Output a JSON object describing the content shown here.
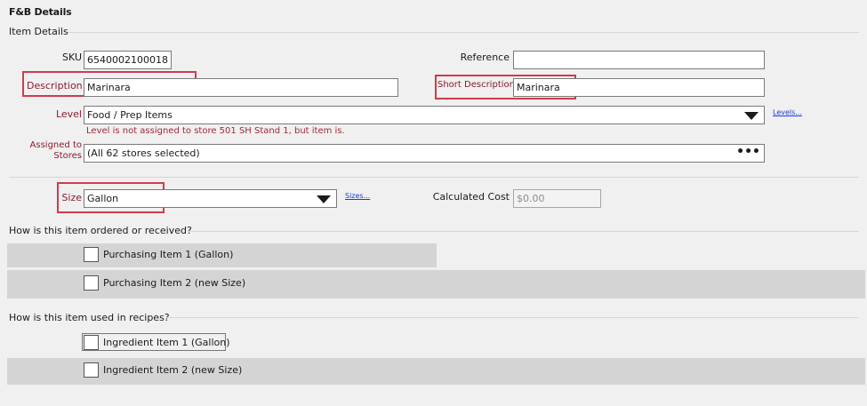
{
  "header": {
    "title": "F&B Details"
  },
  "item_details": {
    "section_label": "Item Details",
    "sku": {
      "label": "SKU",
      "value": "6540002100018"
    },
    "reference": {
      "label": "Reference",
      "value": ""
    },
    "description": {
      "label": "Description",
      "value": "Marinara"
    },
    "short_description": {
      "label": "Short Description",
      "value": "Marinara"
    },
    "level": {
      "label": "Level",
      "value": "Food / Prep Items",
      "link": "Levels...",
      "warning": "Level is not assigned to store 501 SH Stand 1, but item is."
    },
    "assigned_stores": {
      "label_line1": "Assigned to",
      "label_line2": "Stores",
      "value": "(All 62 stores selected)",
      "button": "•••"
    }
  },
  "size": {
    "label": "Size",
    "value": "Gallon",
    "link": "Sizes..."
  },
  "calculated_cost": {
    "label": "Calculated Cost",
    "value": "$0.00"
  },
  "ordering": {
    "question": "How is this item ordered or received?",
    "items": [
      {
        "label": "Purchasing Item 1 (Gallon)",
        "checked": false
      },
      {
        "label": "Purchasing Item 2 (new Size)",
        "checked": false
      }
    ]
  },
  "recipes": {
    "question": "How is this item used in recipes?",
    "items": [
      {
        "label": "Ingredient Item 1 (Gallon)",
        "checked": false
      },
      {
        "label": "Ingredient Item 2 (new Size)",
        "checked": false
      }
    ]
  },
  "colors": {
    "background": "#f0f0f0",
    "band": "#d4d4d4",
    "highlight": "#cf3b4c",
    "warning_text": "#a3283b",
    "link": "#1a3cd6"
  }
}
